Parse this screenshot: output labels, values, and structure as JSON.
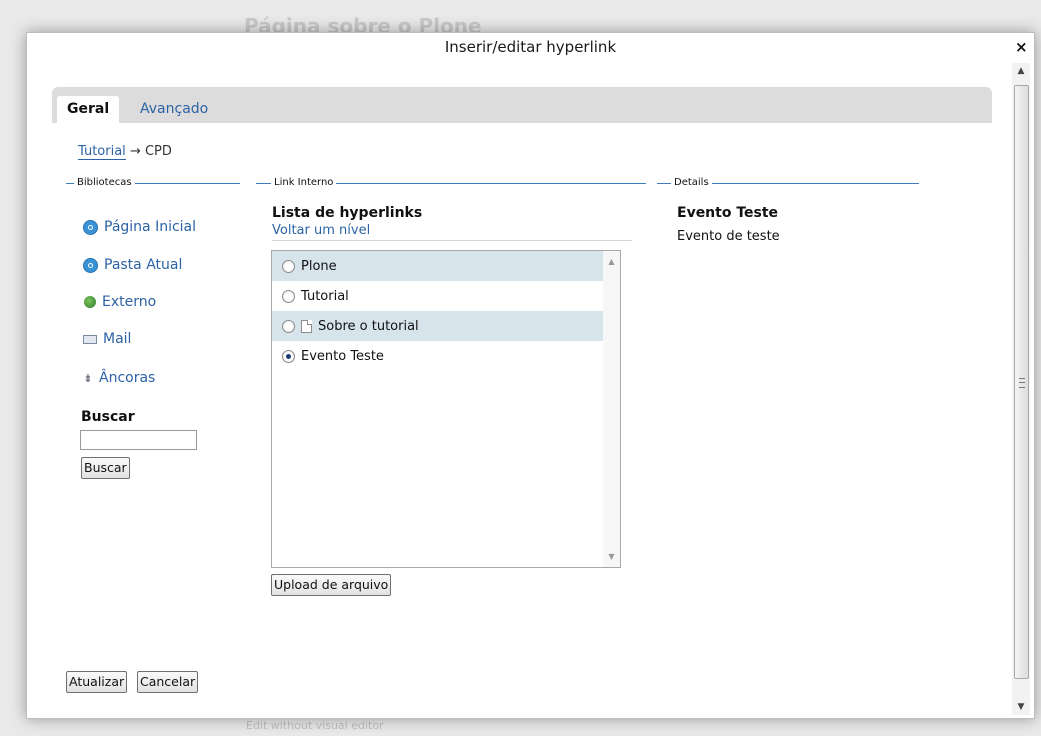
{
  "background": {
    "page_title": "Página sobre o Plone",
    "footer_text": "Edit without visual editor"
  },
  "dialog": {
    "title": "Inserir/editar hyperlink",
    "close_symbol": "×"
  },
  "tabs": [
    {
      "label": "Geral",
      "active": true
    },
    {
      "label": "Avançado",
      "active": false
    }
  ],
  "breadcrumb": {
    "link": "Tutorial",
    "arrow": "→",
    "current": "CPD"
  },
  "sections": {
    "libraries": "Bibliotecas",
    "internal_link": "Link Interno",
    "details": "Details"
  },
  "libraries": [
    {
      "label": "Página Inicial",
      "icon": "home-target-icon"
    },
    {
      "label": "Pasta Atual",
      "icon": "folder-target-icon"
    },
    {
      "label": "Externo",
      "icon": "globe-icon"
    },
    {
      "label": "Mail",
      "icon": "mail-icon"
    },
    {
      "label": "Âncoras",
      "icon": "anchor-icon"
    }
  ],
  "search": {
    "label": "Buscar",
    "value": "",
    "button": "Buscar"
  },
  "link_list": {
    "title": "Lista de hyperlinks",
    "back_link": "Voltar um nível",
    "items": [
      {
        "label": "Plone",
        "selected": false,
        "icon": ""
      },
      {
        "label": "Tutorial",
        "selected": false,
        "icon": ""
      },
      {
        "label": "Sobre o tutorial",
        "selected": false,
        "icon": "document-icon"
      },
      {
        "label": "Evento Teste",
        "selected": true,
        "icon": ""
      }
    ],
    "upload_button": "Upload de arquivo"
  },
  "details": {
    "title": "Evento Teste",
    "description": "Evento de teste"
  },
  "actions": {
    "update": "Atualizar",
    "cancel": "Cancelar"
  },
  "colors": {
    "link": "#2c63a4",
    "legend_line": "#3a7dbb",
    "row_highlight": "#d7e4ec",
    "tab_bar": "#dcdcdc"
  }
}
